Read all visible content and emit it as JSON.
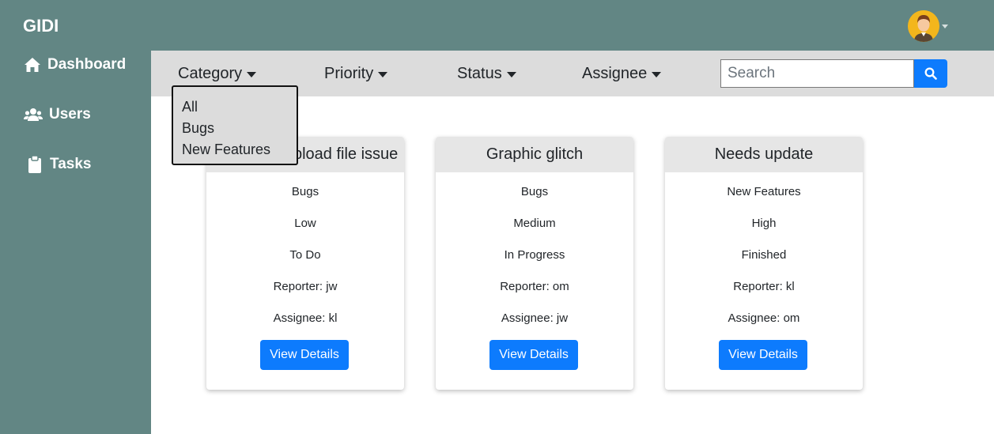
{
  "header": {
    "brand": "GIDI"
  },
  "sidebar": {
    "items": [
      {
        "label": "Dashboard",
        "icon": "home-icon"
      },
      {
        "label": "Users",
        "icon": "users-icon"
      },
      {
        "label": "Tasks",
        "icon": "clipboard-icon"
      }
    ]
  },
  "filters": {
    "category": "Category",
    "priority": "Priority",
    "status": "Status",
    "assignee": "Assignee"
  },
  "search": {
    "placeholder": "Search",
    "value": ""
  },
  "category_dropdown": {
    "options": [
      "All",
      "Bugs",
      "New Features"
    ]
  },
  "cards": [
    {
      "title": "Unable to upload file issue",
      "category": "Bugs",
      "priority": "Low",
      "status": "To Do",
      "reporter": "Reporter: jw",
      "assignee": "Assignee: kl",
      "button": "View Details"
    },
    {
      "title": "Graphic glitch",
      "category": "Bugs",
      "priority": "Medium",
      "status": "In Progress",
      "reporter": "Reporter: om",
      "assignee": "Assignee: jw",
      "button": "View Details"
    },
    {
      "title": "Needs update",
      "category": "New Features",
      "priority": "High",
      "status": "Finished",
      "reporter": "Reporter: kl",
      "assignee": "Assignee: om",
      "button": "View Details"
    }
  ],
  "colors": {
    "sidebar": "#628684",
    "accent": "#0d7bfd",
    "filterbar": "#dcdcdc"
  }
}
